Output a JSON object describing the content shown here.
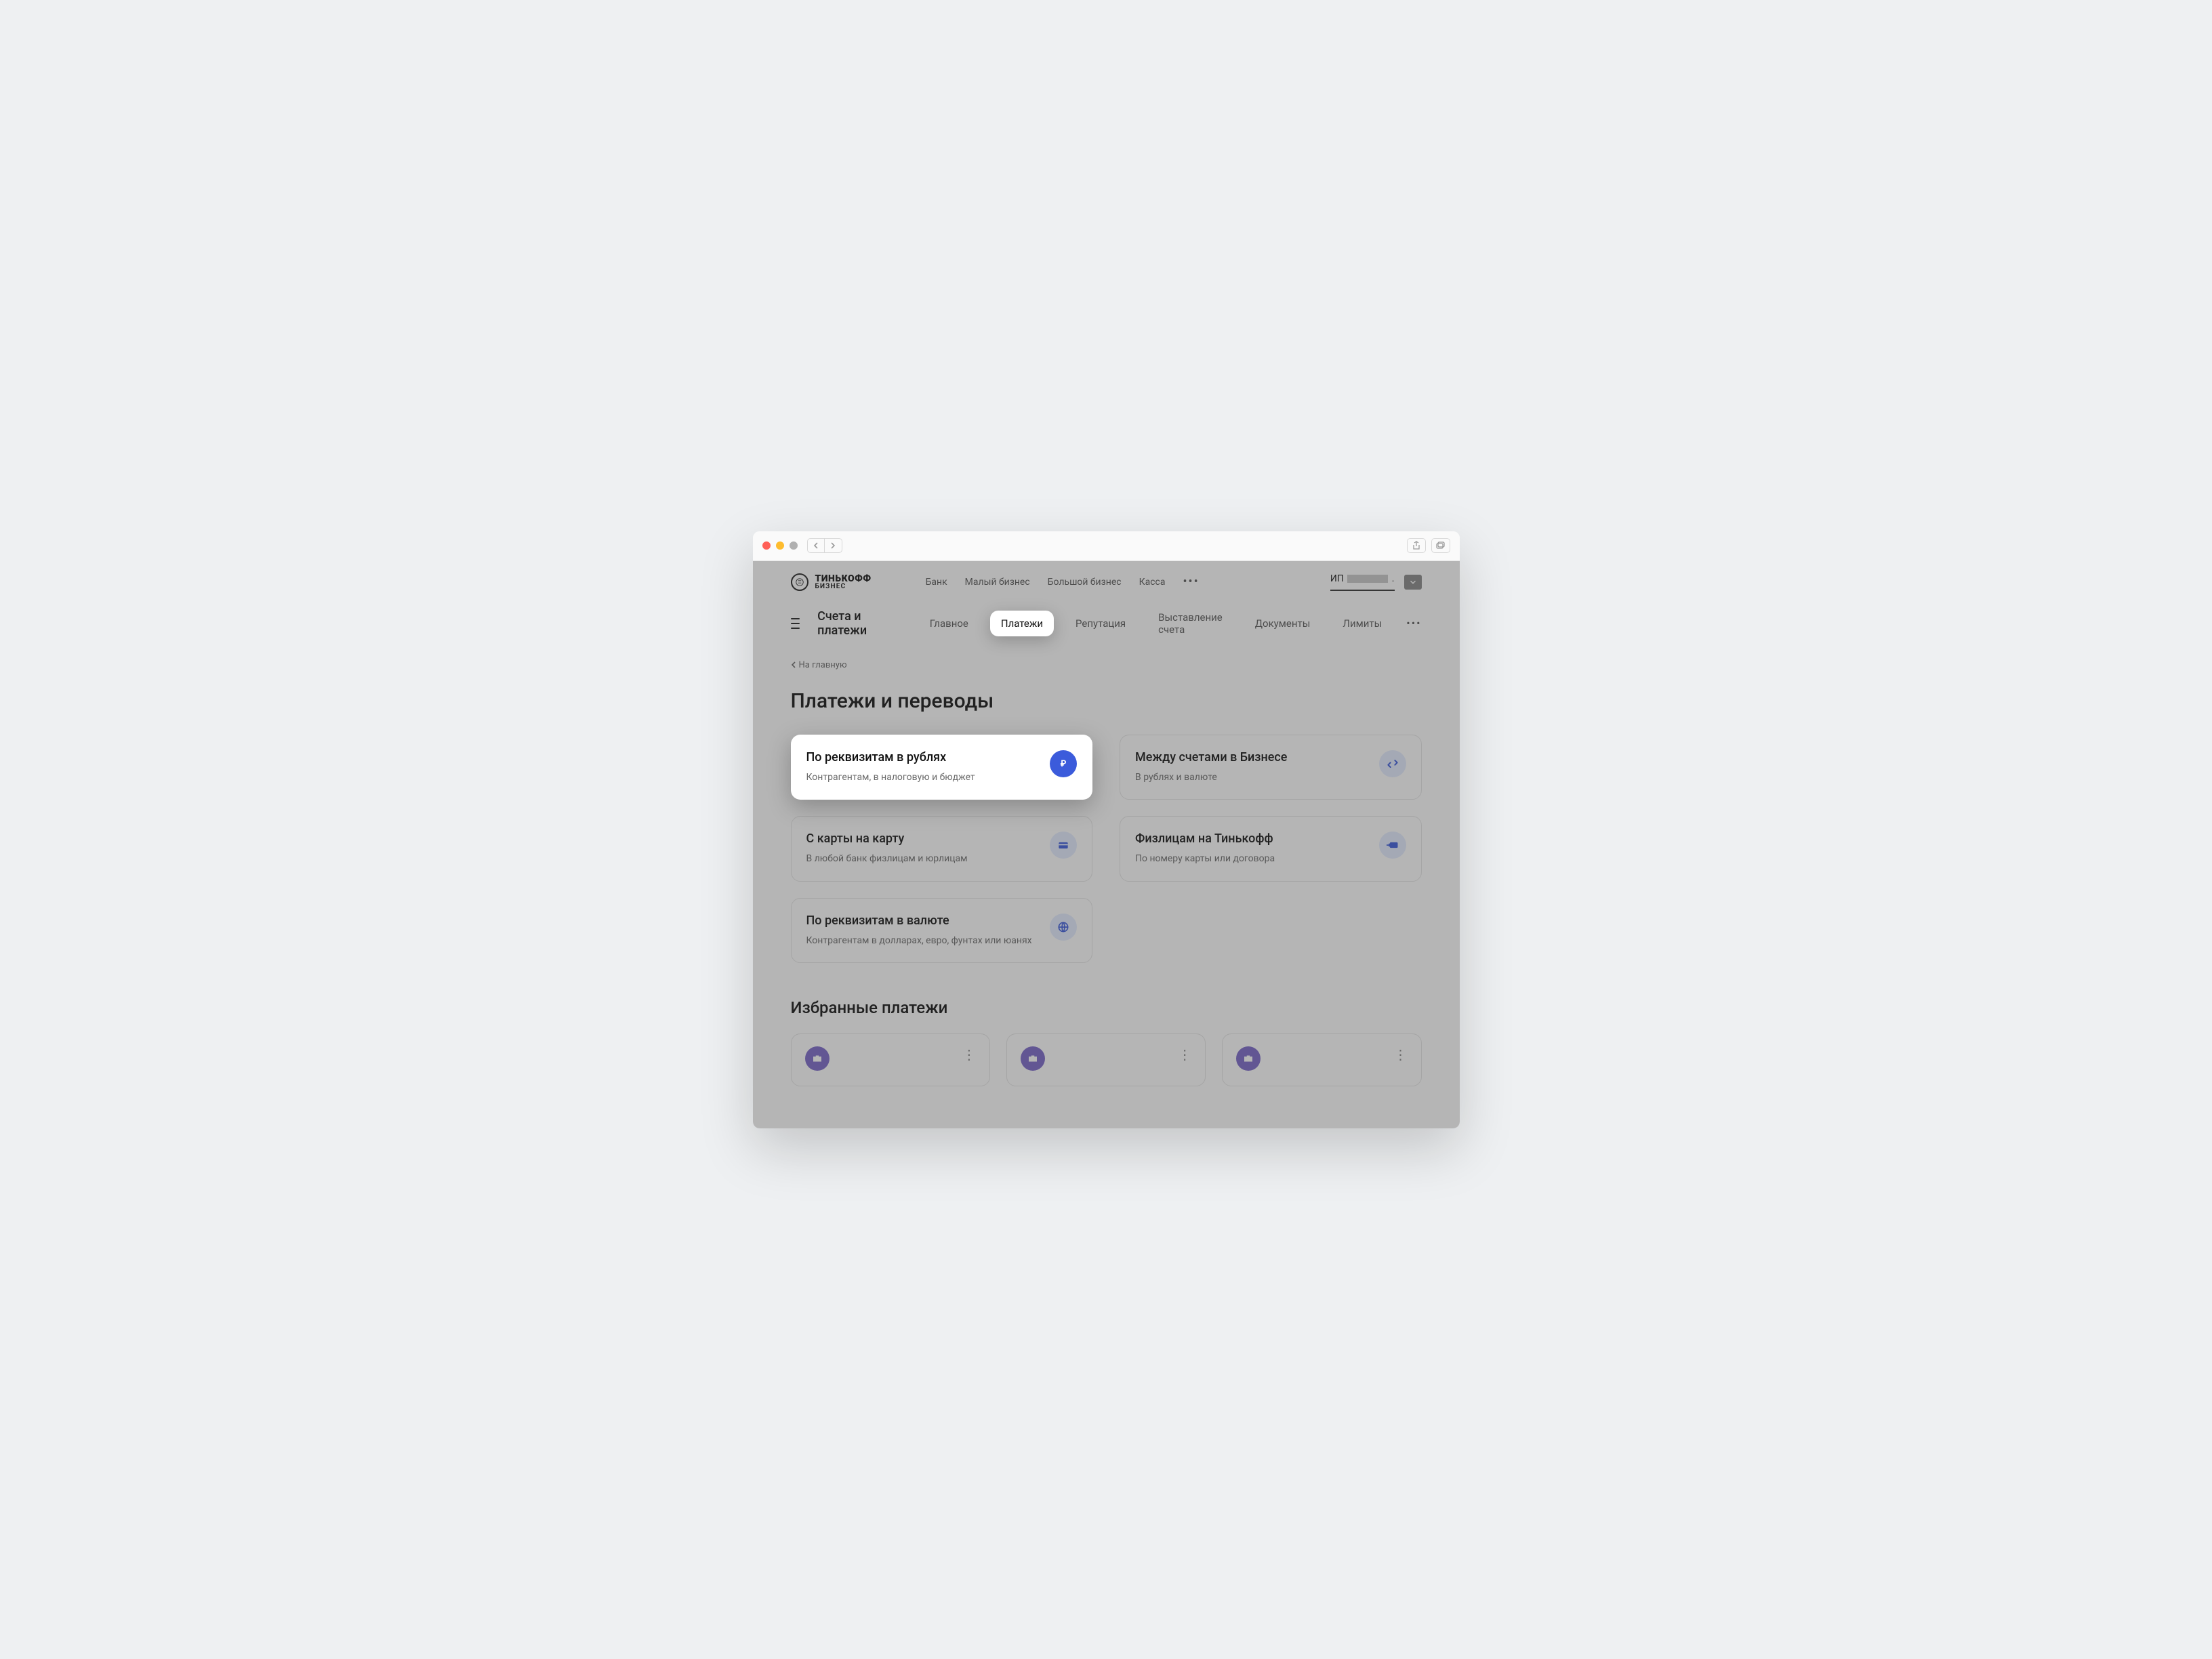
{
  "brand": {
    "title": "ТИНЬКОФФ",
    "subtitle": "БИЗНЕС"
  },
  "topmenu": {
    "items": [
      "Банк",
      "Малый бизнес",
      "Большой бизнес",
      "Касса"
    ]
  },
  "user": {
    "prefix": "ИП",
    "suffix": "."
  },
  "section": {
    "title": "Счета и платежи"
  },
  "tabs": {
    "items": [
      "Главное",
      "Платежи",
      "Репутация",
      "Выставление счета",
      "Документы",
      "Лимиты"
    ],
    "active_index": 1
  },
  "back": {
    "label": "На главную"
  },
  "page": {
    "title": "Платежи и переводы"
  },
  "cards": [
    {
      "title": "По реквизитам в рублях",
      "subtitle": "Контрагентам, в налоговую и бюджет",
      "icon": "ruble-circle",
      "highlighted": true
    },
    {
      "title": "Между счетами в Бизнесе",
      "subtitle": "В рублях и валюте",
      "icon": "transfer"
    },
    {
      "title": "С карты на карту",
      "subtitle": "В любой банк физлицам и юрлицам",
      "icon": "card"
    },
    {
      "title": "Физлицам на Тинькофф",
      "subtitle": "По номеру карты или договора",
      "icon": "card-in"
    },
    {
      "title": "По реквизитам в валюте",
      "subtitle": "Контрагентам в долларах, евро, фунтах или юанях",
      "icon": "globe"
    }
  ],
  "favorites": {
    "title": "Избранные платежи",
    "count": 3
  }
}
